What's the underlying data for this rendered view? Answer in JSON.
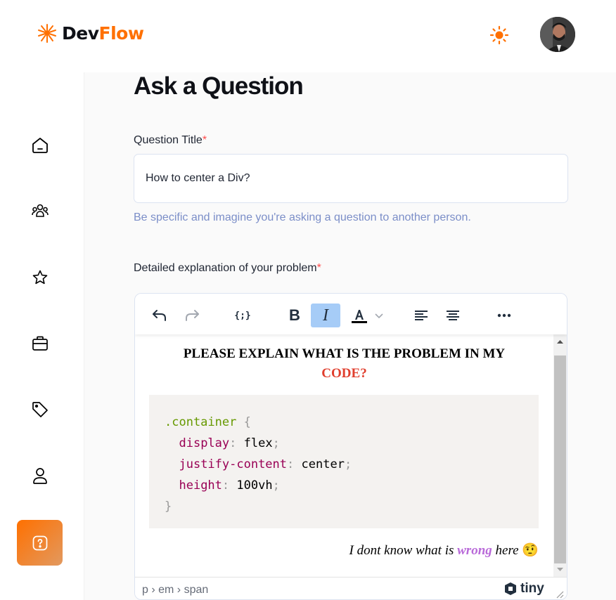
{
  "brand": {
    "part1": "Dev",
    "part2": "Flow"
  },
  "header": {
    "theme_icon": "sun-icon",
    "avatar_icon": "user-avatar"
  },
  "sidebar": {
    "items": [
      {
        "icon": "home-icon"
      },
      {
        "icon": "community-icon"
      },
      {
        "icon": "star-icon"
      },
      {
        "icon": "briefcase-icon"
      },
      {
        "icon": "tag-icon"
      },
      {
        "icon": "user-icon"
      },
      {
        "icon": "question-icon",
        "active": true
      }
    ]
  },
  "page": {
    "title": "Ask a Question"
  },
  "form": {
    "title_label": "Question Title",
    "required_mark": "*",
    "title_value": "How to center a Div?",
    "title_hint": "Be specific and imagine you're asking a question to another person.",
    "explanation_label": "Detailed explanation of your problem"
  },
  "editor": {
    "toolbar": [
      "undo-icon",
      "redo-icon",
      "code-sample-icon",
      "bold-icon",
      "italic-icon",
      "text-color-icon",
      "chevron-down-icon",
      "align-left-icon",
      "align-center-icon",
      "more-icon"
    ],
    "heading_black": "PLEASE EXPLAIN WHAT IS THE PROBLEM IN MY",
    "heading_red": "CODE?",
    "code": {
      "selector": ".container",
      "open": "{",
      "close": "}",
      "lines": [
        {
          "prop": "display",
          "value": "flex"
        },
        {
          "prop": "justify-content",
          "value": "center"
        },
        {
          "prop": "height",
          "value": "100vh"
        }
      ]
    },
    "note_prefix": "I dont know what is ",
    "note_emphasis": "wrong",
    "note_suffix": " here",
    "note_emoji": "🤨",
    "status_path": "p › em › span",
    "brand": "tiny"
  },
  "colors": {
    "accent": "#ff7000",
    "hint": "#7b8ec8",
    "required": "#ff4d4d"
  }
}
